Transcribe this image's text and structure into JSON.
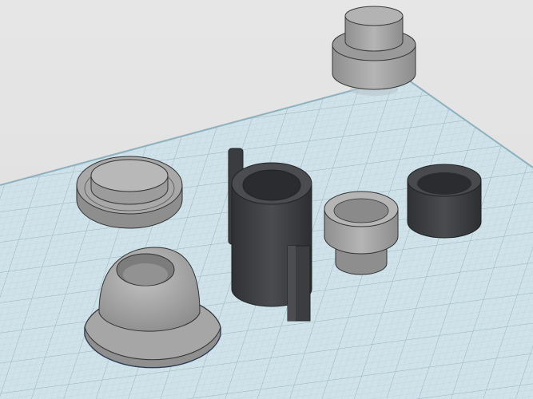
{
  "workplane": {
    "label": ""
  },
  "colors": {
    "background": "#e9e9e9",
    "grid_fill": "#cfe3ea",
    "grid_line_minor": "#b5cbd3",
    "grid_line_major": "#9eb8c2",
    "part_light": "#a9a9a9",
    "part_light_top": "#bdbdbd",
    "part_mid": "#8a8a8a",
    "part_dark": "#3b3d40",
    "part_dark_top": "#4a4c50",
    "edge": "#2a2a2a",
    "shadow": "#b9c6cc"
  },
  "objects": [
    {
      "name": "stepped-cylinder",
      "icon": "stepped-cylinder-icon"
    },
    {
      "name": "flanged-disc",
      "icon": "flanged-disc-icon"
    },
    {
      "name": "dome-ring",
      "icon": "dome-ring-icon"
    },
    {
      "name": "tube-with-tabs",
      "icon": "tube-with-tabs-icon"
    },
    {
      "name": "small-cup",
      "icon": "small-cup-icon"
    },
    {
      "name": "dark-ring",
      "icon": "dark-ring-icon"
    }
  ]
}
